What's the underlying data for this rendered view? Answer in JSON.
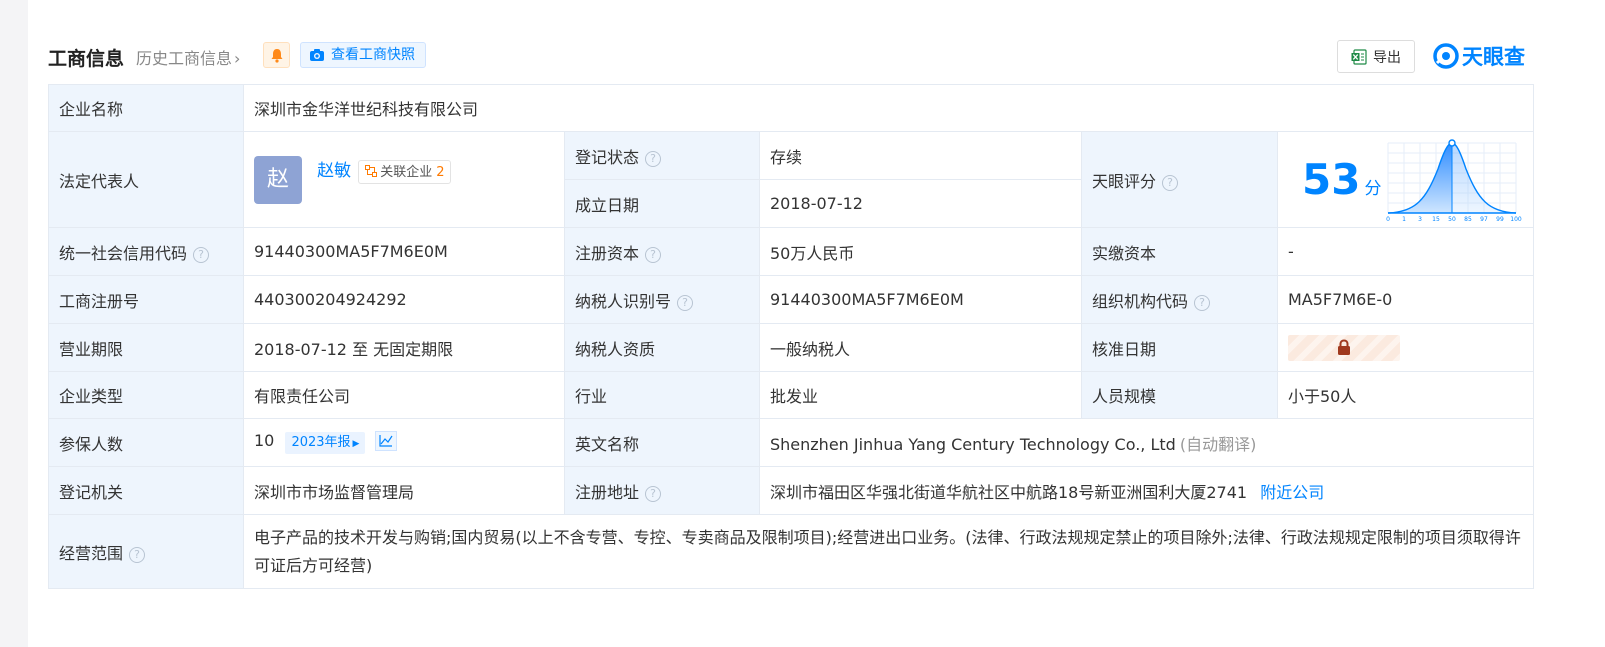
{
  "header": {
    "title": "工商信息",
    "history_link": "历史工商信息",
    "history_chevron": "›",
    "snapshot_button": "查看工商快照",
    "export_button": "导出",
    "logo_text": "天眼查",
    "accent_color": "#0084ff"
  },
  "rows": {
    "company_name": {
      "label": "企业名称",
      "value": "深圳市金华洋世纪科技有限公司"
    },
    "legal_rep": {
      "label": "法定代表人",
      "avatar_char": "赵",
      "name": "赵敏",
      "related_label": "关联企业",
      "related_count": "2"
    },
    "reg_status": {
      "label": "登记状态",
      "value": "存续",
      "value_color": "#15a04a"
    },
    "established": {
      "label": "成立日期",
      "value": "2018-07-12"
    },
    "tianyan_score": {
      "label": "天眼评分",
      "score": "53",
      "unit": "分",
      "axis_ticks": [
        "0",
        "1",
        "3",
        "15",
        "50",
        "85",
        "97",
        "99",
        "100"
      ]
    },
    "credit_code": {
      "label": "统一社会信用代码",
      "value": "91440300MA5F7M6E0M"
    },
    "reg_capital": {
      "label": "注册资本",
      "value": "50万人民币"
    },
    "paid_capital": {
      "label": "实缴资本",
      "value": "-"
    },
    "reg_number": {
      "label": "工商注册号",
      "value": "440300204924292"
    },
    "taxpayer_id": {
      "label": "纳税人识别号",
      "value": "91440300MA5F7M6E0M"
    },
    "org_code": {
      "label": "组织机构代码",
      "value": "MA5F7M6E-0"
    },
    "term": {
      "label": "营业期限",
      "value": "2018-07-12 至 无固定期限"
    },
    "taxpayer_type": {
      "label": "纳税人资质",
      "value": "一般纳税人"
    },
    "approval_date": {
      "label": "核准日期",
      "locked_icon": "lock-icon"
    },
    "company_type": {
      "label": "企业类型",
      "value": "有限责任公司"
    },
    "industry": {
      "label": "行业",
      "value": "批发业"
    },
    "staff_size": {
      "label": "人员规模",
      "value": "小于50人"
    },
    "insured": {
      "label": "参保人数",
      "value": "10",
      "year_tag": "2023年报"
    },
    "english_name": {
      "label": "英文名称",
      "value": "Shenzhen Jinhua Yang Century Technology Co., Ltd",
      "note": "(自动翻译)"
    },
    "authority": {
      "label": "登记机关",
      "value": "深圳市市场监督管理局"
    },
    "address": {
      "label": "注册地址",
      "value": "深圳市福田区华强北街道华航社区中航路18号新亚洲国利大厦2741",
      "nearby_link": "附近公司"
    },
    "scope": {
      "label": "经营范围",
      "value": "电子产品的技术开发与购销;国内贸易(以上不含专营、专控、专卖商品及限制项目);经营进出口业务。(法律、行政法规规定禁止的项目除外;法律、行政法规规定限制的项目须取得许可证后方可经营)"
    }
  }
}
